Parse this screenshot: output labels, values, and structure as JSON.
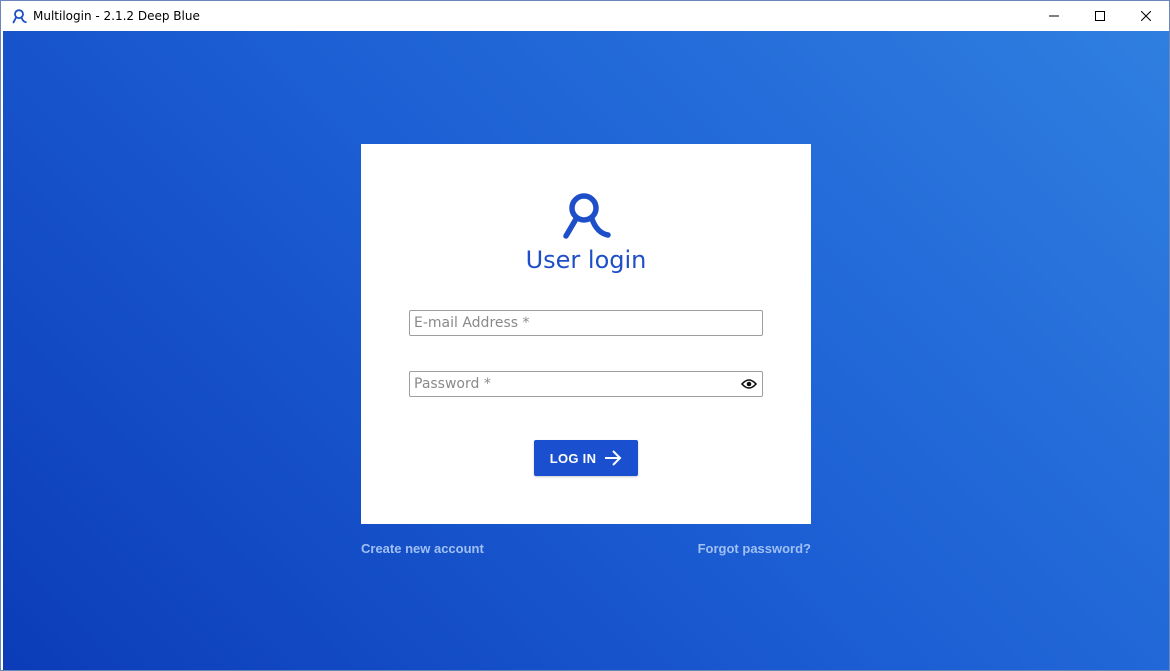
{
  "window": {
    "title": "Multilogin - 2.1.2 Deep Blue",
    "icon": "multilogin-logo-icon",
    "controls": {
      "minimize_icon": "minimize-icon",
      "maximize_icon": "maximize-icon",
      "close_icon": "close-icon"
    }
  },
  "login": {
    "logo_icon": "multilogin-logo-icon",
    "title": "User login",
    "email": {
      "placeholder": "E-mail Address *",
      "value": ""
    },
    "password": {
      "placeholder": "Password *",
      "value": "",
      "toggle_icon": "eye-icon"
    },
    "submit_label": "LOG IN",
    "submit_icon": "arrow-right-icon"
  },
  "links": {
    "create_account": "Create new account",
    "forgot_password": "Forgot password?"
  },
  "colors": {
    "accent": "#1a4fd0",
    "title_text": "#1f4fc8",
    "background_start": "#0c3cb8",
    "background_end": "#2f7fe0",
    "link_text": "#9fc0f2"
  }
}
